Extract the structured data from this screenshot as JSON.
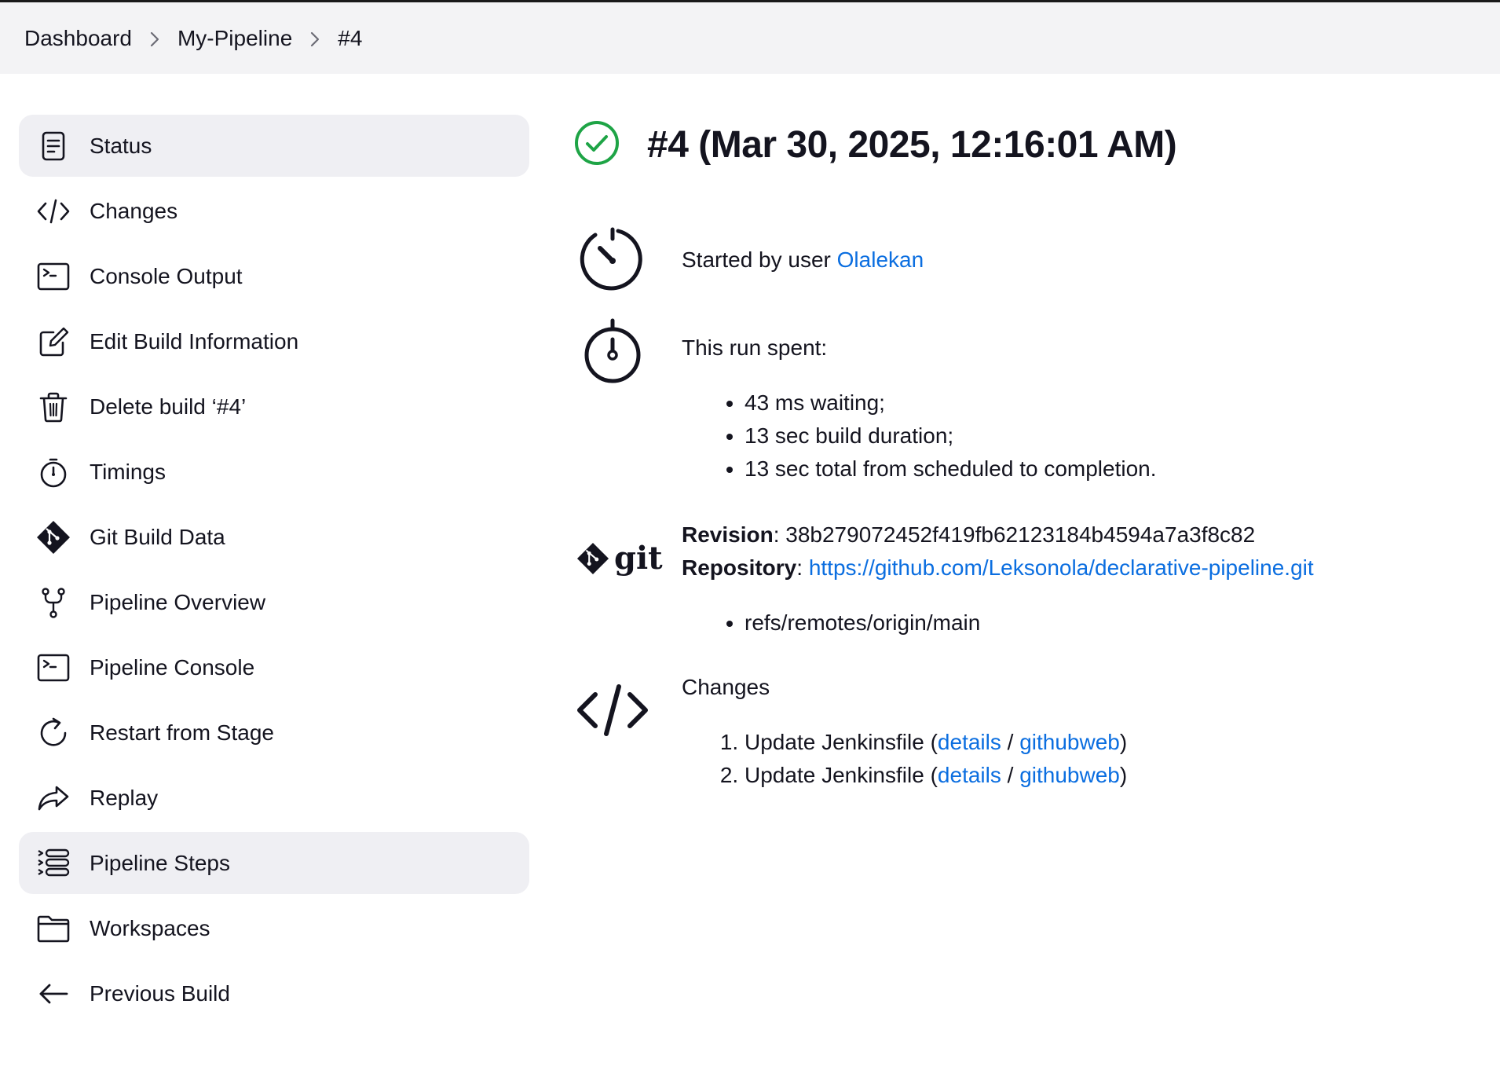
{
  "breadcrumb": {
    "items": [
      "Dashboard",
      "My-Pipeline",
      "#4"
    ]
  },
  "sidebar": {
    "items": [
      {
        "label": "Status",
        "icon": "document-icon",
        "active": true
      },
      {
        "label": "Changes",
        "icon": "code-icon"
      },
      {
        "label": "Console Output",
        "icon": "terminal-icon"
      },
      {
        "label": "Edit Build Information",
        "icon": "edit-icon"
      },
      {
        "label": "Delete build ‘#4’",
        "icon": "trash-icon"
      },
      {
        "label": "Timings",
        "icon": "stopwatch-icon"
      },
      {
        "label": "Git Build Data",
        "icon": "git-icon"
      },
      {
        "label": "Pipeline Overview",
        "icon": "fork-icon"
      },
      {
        "label": "Pipeline Console",
        "icon": "terminal-icon"
      },
      {
        "label": "Restart from Stage",
        "icon": "restart-icon"
      },
      {
        "label": "Replay",
        "icon": "replay-icon"
      },
      {
        "label": "Pipeline Steps",
        "icon": "steps-list-icon",
        "active": true
      },
      {
        "label": "Workspaces",
        "icon": "folder-icon"
      },
      {
        "label": "Previous Build",
        "icon": "arrow-left-icon"
      }
    ]
  },
  "main": {
    "title": "#4 (Mar 30, 2025, 12:16:01 AM)",
    "status_icon": "success-check-icon",
    "started_by": {
      "prefix": "Started by user ",
      "user": "Olalekan"
    },
    "timing": {
      "heading": "This run spent:",
      "items": [
        "43 ms waiting;",
        "13 sec build duration;",
        "13 sec total from scheduled to completion."
      ]
    },
    "git": {
      "revision_label": "Revision",
      "revision": "38b279072452f419fb62123184b4594a7a3f8c82",
      "repository_label": "Repository",
      "repository": "https://github.com/Leksonola/declarative-pipeline.git",
      "refs": [
        "refs/remotes/origin/main"
      ],
      "logo_text": "git"
    },
    "changes": {
      "heading": "Changes",
      "items": [
        {
          "text": "Update Jenkinsfile",
          "details": "details",
          "web": "githubweb"
        },
        {
          "text": "Update Jenkinsfile",
          "details": "details",
          "web": "githubweb"
        }
      ]
    }
  }
}
